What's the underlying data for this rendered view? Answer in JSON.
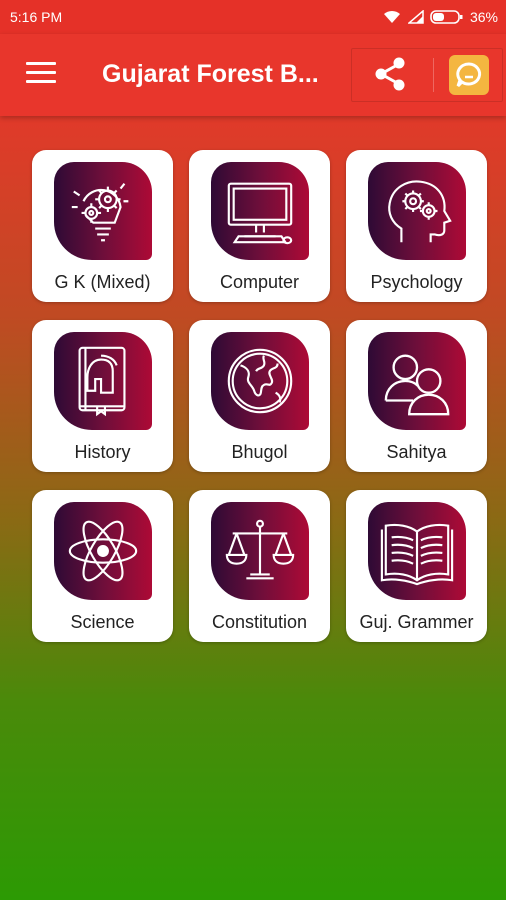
{
  "status_bar": {
    "time": "5:16 PM",
    "battery": "36%"
  },
  "app_bar": {
    "title": "Gujarat Forest B...",
    "menu_icon": "hamburger-menu-icon",
    "share_icon": "share-icon",
    "chat_icon": "chat-bubble-icon"
  },
  "colors": {
    "app_bar": "#e8362c",
    "gradient_top": "#e8322a",
    "gradient_bottom": "#2c9a04",
    "tile_icon_dark": "#2e0a35",
    "tile_icon_light": "#ad0a36",
    "chat_button": "#f4b640"
  },
  "categories": [
    {
      "label": "G K (Mixed)",
      "icon": "lightbulb-gears-icon"
    },
    {
      "label": "Computer",
      "icon": "desktop-computer-icon"
    },
    {
      "label": "Psychology",
      "icon": "head-gears-icon"
    },
    {
      "label": "History",
      "icon": "spartan-helmet-book-icon"
    },
    {
      "label": "Bhugol",
      "icon": "globe-icon"
    },
    {
      "label": "Sahitya",
      "icon": "two-people-icon"
    },
    {
      "label": "Science",
      "icon": "atom-icon"
    },
    {
      "label": "Constitution",
      "icon": "scales-of-justice-icon"
    },
    {
      "label": "Guj. Grammer",
      "icon": "open-book-icon"
    }
  ]
}
